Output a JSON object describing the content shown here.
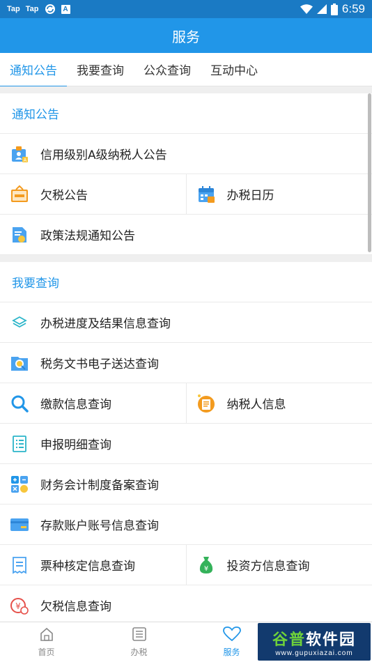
{
  "status_bar": {
    "notifications": [
      "Tap",
      "Tap"
    ],
    "box_icon_letter": "A",
    "battery_level": "6",
    "time": "6:59"
  },
  "app_bar": {
    "title": "服务"
  },
  "tabs": [
    {
      "label": "通知公告",
      "active": true
    },
    {
      "label": "我要查询",
      "active": false
    },
    {
      "label": "公众查询",
      "active": false
    },
    {
      "label": "互动中心",
      "active": false
    }
  ],
  "notice_section": {
    "title": "通知公告",
    "items": [
      {
        "label": "信用级别A级纳税人公告",
        "icon": "badge-a-icon"
      },
      {
        "label": "欠税公告",
        "icon": "notice-board-icon"
      },
      {
        "label": "办税日历",
        "icon": "calendar-icon"
      },
      {
        "label": "政策法规通知公告",
        "icon": "policy-document-icon"
      }
    ]
  },
  "query_section": {
    "title": "我要查询",
    "items": [
      {
        "label": "办税进度及结果信息查询",
        "icon": "layers-icon"
      },
      {
        "label": "税务文书电子送达查询",
        "icon": "document-search-icon"
      },
      {
        "label": "缴款信息查询",
        "icon": "search-icon"
      },
      {
        "label": "纳税人信息",
        "icon": "taxpayer-info-icon"
      },
      {
        "label": "申报明细查询",
        "icon": "list-document-icon"
      },
      {
        "label": "财务会计制度备案查询",
        "icon": "calculator-icon"
      },
      {
        "label": "存款账户账号信息查询",
        "icon": "bank-card-icon"
      },
      {
        "label": "票种核定信息查询",
        "icon": "invoice-icon"
      },
      {
        "label": "投资方信息查询",
        "icon": "money-bag-icon"
      },
      {
        "label": "欠税信息查询",
        "icon": "tax-arrears-icon"
      }
    ]
  },
  "bottom_nav": [
    {
      "label": "首页",
      "icon": "home-icon",
      "active": false
    },
    {
      "label": "办税",
      "icon": "list-icon",
      "active": false
    },
    {
      "label": "服务",
      "icon": "heart-icon",
      "active": true
    }
  ],
  "watermark": {
    "brand_green": "谷普",
    "brand_white": "软件园",
    "url": "www.gupuxiazai.com"
  },
  "colors": {
    "primary": "#2196e8",
    "status_bar": "#1a7ac4",
    "orange": "#f39b1f"
  }
}
